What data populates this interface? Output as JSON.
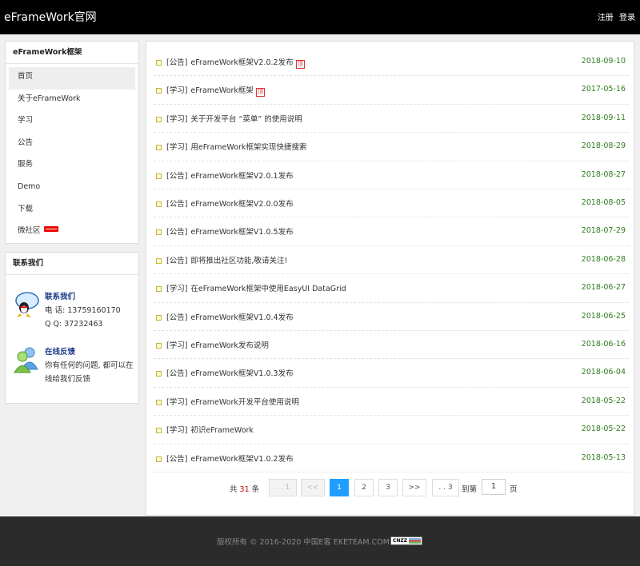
{
  "header": {
    "brand": "eFrameWork官网",
    "register": "注册",
    "login": "登录"
  },
  "menu": {
    "title": "eFrameWork框架",
    "items": [
      {
        "label": "首页"
      },
      {
        "label": "关于eFrameWork"
      },
      {
        "label": "学习"
      },
      {
        "label": "公告"
      },
      {
        "label": "服务"
      },
      {
        "label": "Demo"
      },
      {
        "label": "下载"
      },
      {
        "label": "微社区"
      }
    ]
  },
  "contact": {
    "title": "联系我们",
    "contact_heading": "联系我们",
    "phone": "电 话: 13759160170",
    "qq": "Q  Q: 37232463",
    "feedback_heading": "在线反馈",
    "feedback_text": "你有任何的问题, 都可以在线给我们反馈"
  },
  "news": [
    {
      "cat": "[公告]",
      "title": "eFrameWork框架V2.0.2发布",
      "top": true,
      "date": "2018-09-10"
    },
    {
      "cat": "[学习]",
      "title": "eFrameWork框架",
      "top": true,
      "date": "2017-05-16"
    },
    {
      "cat": "[学习]",
      "title": "关于开发平台 “菜单” 的使用说明",
      "top": false,
      "date": "2018-09-11"
    },
    {
      "cat": "[学习]",
      "title": "用eFrameWork框架实现快捷搜索",
      "top": false,
      "date": "2018-08-29"
    },
    {
      "cat": "[公告]",
      "title": "eFrameWork框架V2.0.1发布",
      "top": false,
      "date": "2018-08-27"
    },
    {
      "cat": "[公告]",
      "title": "eFrameWork框架V2.0.0发布",
      "top": false,
      "date": "2018-08-05"
    },
    {
      "cat": "[公告]",
      "title": "eFrameWork框架V1.0.5发布",
      "top": false,
      "date": "2018-07-29"
    },
    {
      "cat": "[公告]",
      "title": "即将推出社区功能,敬请关注!",
      "top": false,
      "date": "2018-06-28"
    },
    {
      "cat": "[学习]",
      "title": "在eFrameWork框架中使用EasyUI DataGrid",
      "top": false,
      "date": "2018-06-27"
    },
    {
      "cat": "[公告]",
      "title": "eFrameWork框架V1.0.4发布",
      "top": false,
      "date": "2018-06-25"
    },
    {
      "cat": "[学习]",
      "title": "eFrameWork发布说明",
      "top": false,
      "date": "2018-06-16"
    },
    {
      "cat": "[公告]",
      "title": "eFrameWork框架V1.0.3发布",
      "top": false,
      "date": "2018-06-04"
    },
    {
      "cat": "[学习]",
      "title": "eFrameWork开发平台使用说明",
      "top": false,
      "date": "2018-05-22"
    },
    {
      "cat": "[学习]",
      "title": "初识eFrameWork",
      "top": false,
      "date": "2018-05-22"
    },
    {
      "cat": "[公告]",
      "title": "eFrameWork框架V1.0.2发布",
      "top": false,
      "date": "2018-05-13"
    }
  ],
  "top_tag": "顶",
  "pager": {
    "total_prefix": "共",
    "total": "31",
    "total_suffix": "条",
    "first": "1",
    "prev": "<<",
    "pages": [
      "1",
      "2",
      "3"
    ],
    "next": ">>",
    "last": "3",
    "goto_label": "到第",
    "goto_value": "1",
    "goto_suffix": "页"
  },
  "footer": {
    "copyright": "版权所有 © 2016-2020 中国E客 EKETEAM.COM",
    "badge": "CNZZ"
  },
  "colors": {
    "date_green": "#2e7d1e",
    "pager_active": "#1e9fff",
    "header_bg": "#000000",
    "footer_bg": "#2b2b2b"
  }
}
